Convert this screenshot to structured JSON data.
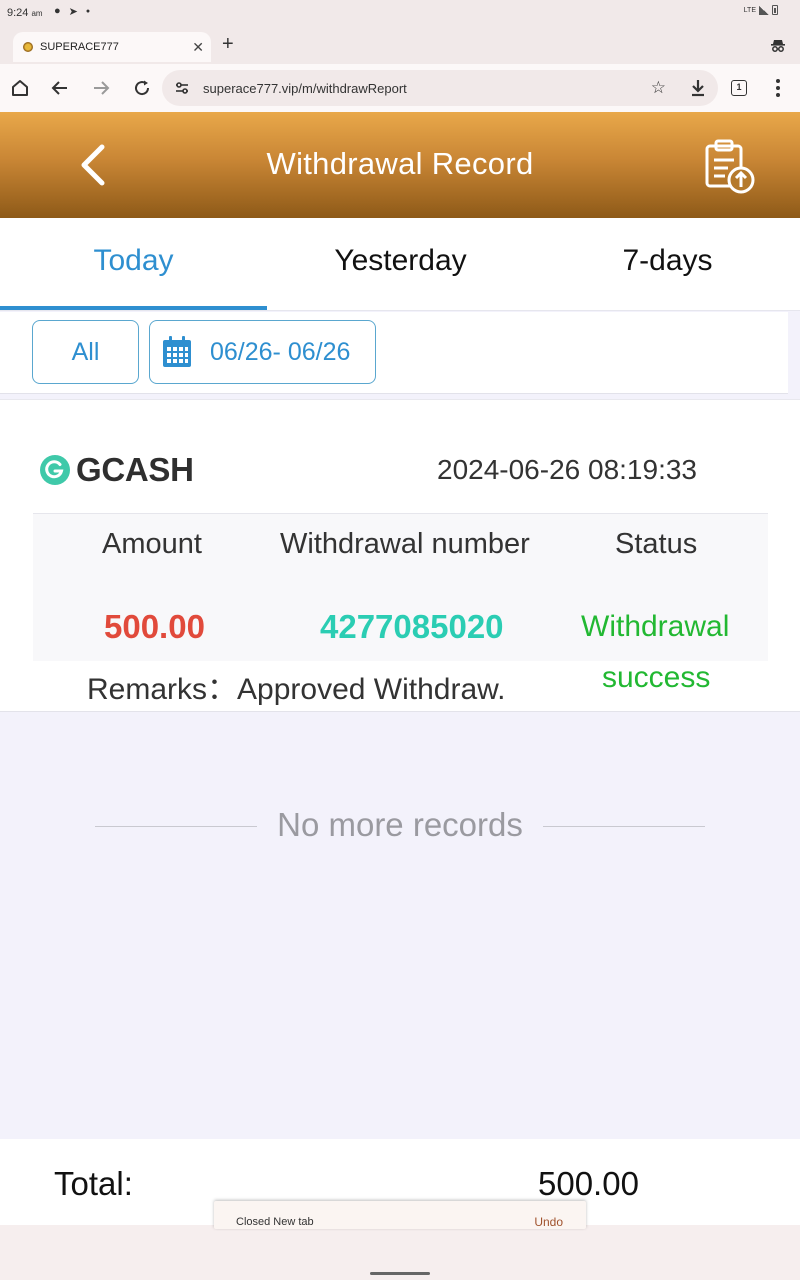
{
  "status_bar": {
    "time": "9:24",
    "ampm": "am",
    "network": "LTE"
  },
  "browser": {
    "tab_title": "SUPERACE777",
    "url": "superace777.vip/m/withdrawReport",
    "tab_count": "1"
  },
  "header": {
    "title": "Withdrawal Record"
  },
  "tabs": [
    {
      "label": "Today",
      "active": true
    },
    {
      "label": "Yesterday",
      "active": false
    },
    {
      "label": "7-days",
      "active": false
    }
  ],
  "filters": {
    "type_label": "All",
    "date_range": "06/26- 06/26"
  },
  "record": {
    "method": "GCASH",
    "datetime": "2024-06-26 08:19:33",
    "headers": {
      "amount": "Amount",
      "number": "Withdrawal number",
      "status": "Status"
    },
    "amount": "500.00",
    "number": "4277085020",
    "status_line1": "Withdrawal",
    "status_line2": "success",
    "remarks_label": "Remarks：",
    "remarks_value": "Approved Withdraw."
  },
  "list_end_text": "No more records",
  "total": {
    "label": "Total:",
    "value": "500.00"
  },
  "snackbar": {
    "message": "Closed New tab",
    "action": "Undo"
  },
  "colors": {
    "accent": "#2e8fd0",
    "amount": "#e14a3b",
    "number": "#2bcdb3",
    "success": "#22b832",
    "header_gold": "#c98635"
  }
}
